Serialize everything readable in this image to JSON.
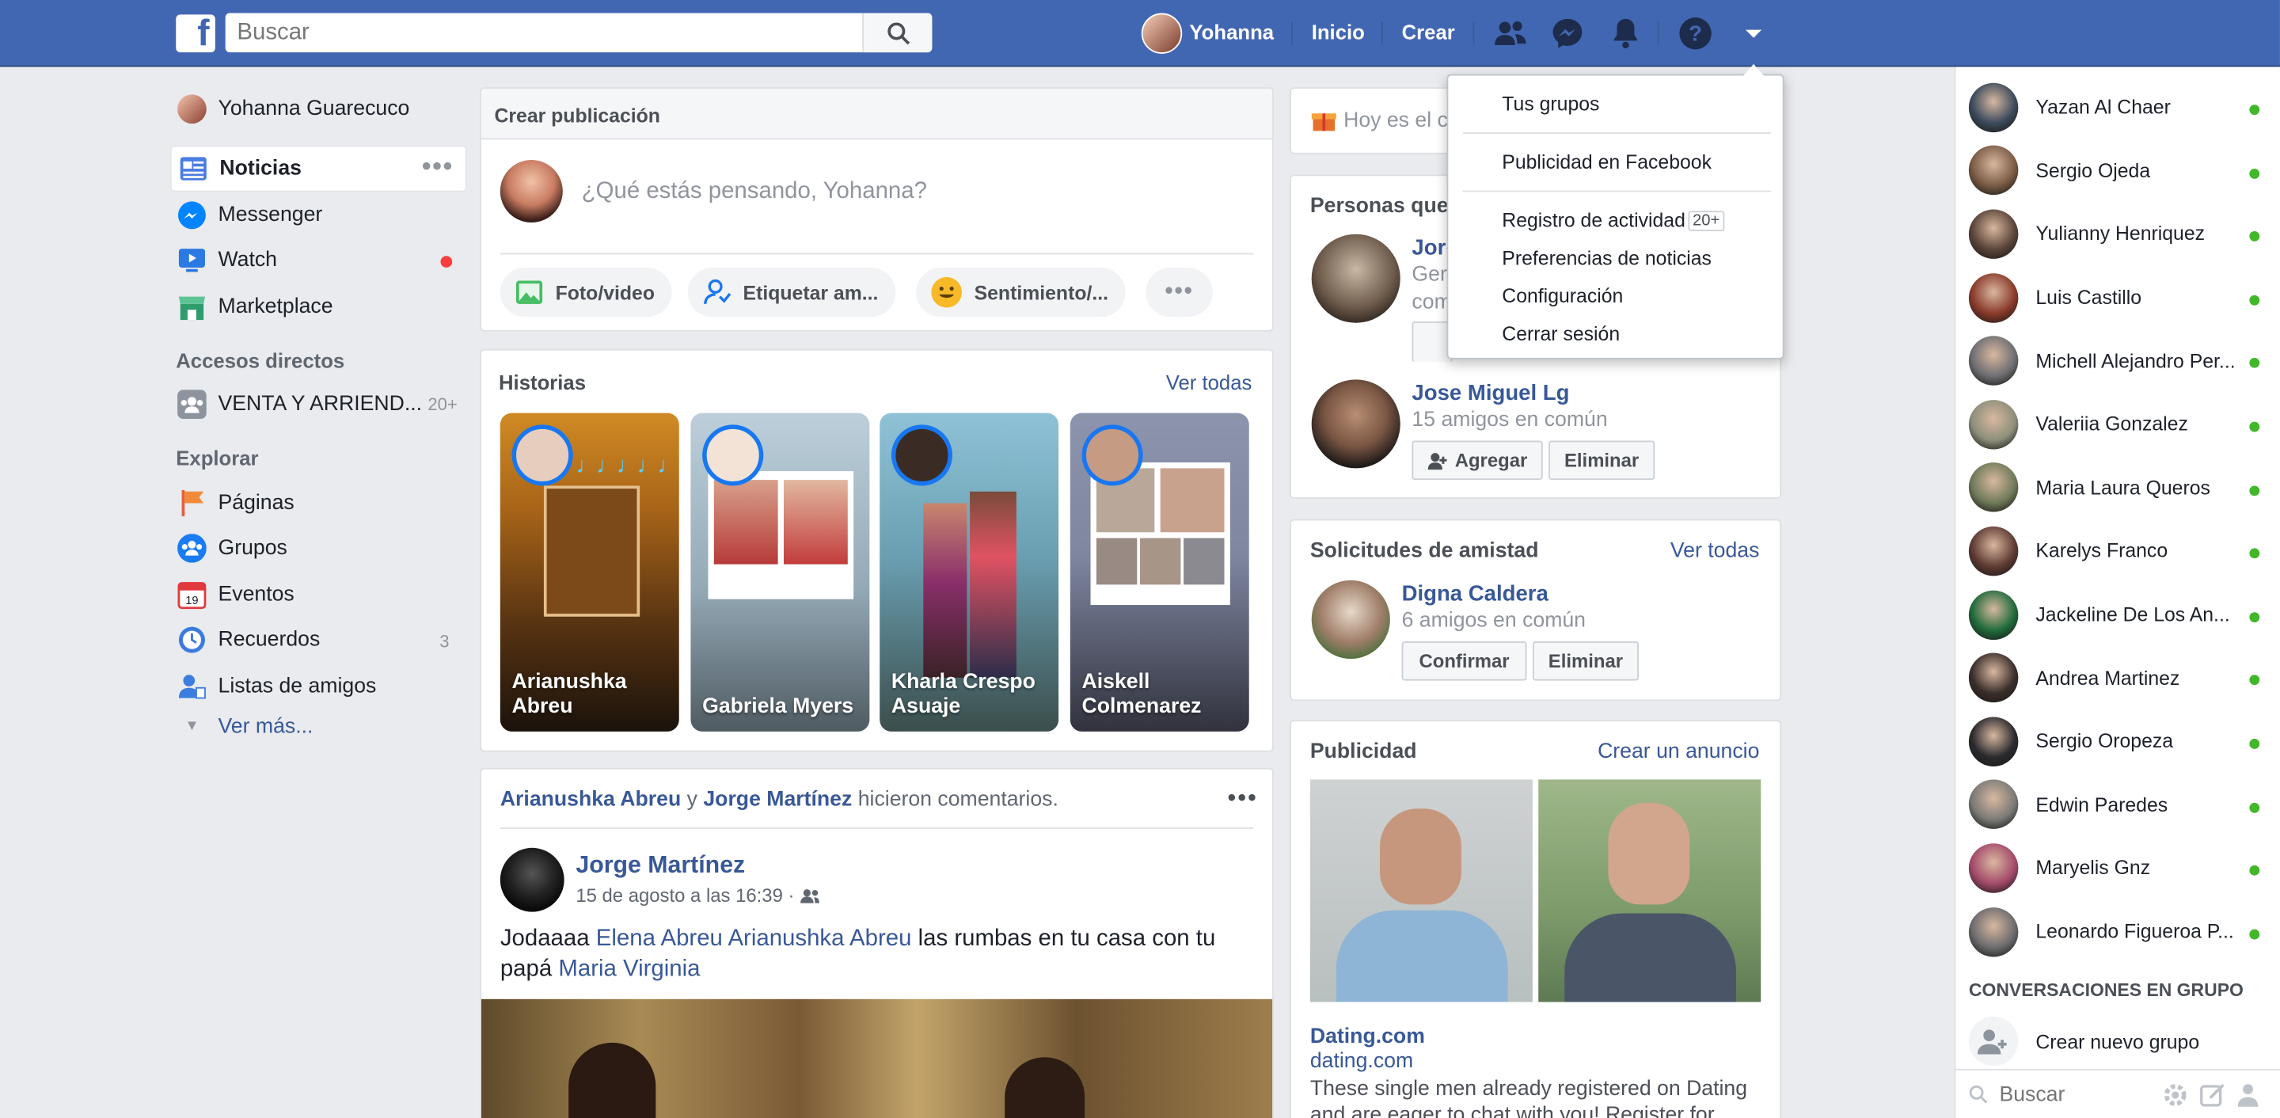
{
  "topbar": {
    "search_placeholder": "Buscar",
    "user_name": "Yohanna",
    "home": "Inicio",
    "create": "Crear"
  },
  "dropdown": {
    "items": [
      "Tus grupos",
      "Publicidad en Facebook",
      "Registro de actividad",
      "Preferencias de noticias",
      "Configuración",
      "Cerrar sesión"
    ],
    "activity_badge": "20+"
  },
  "leftnav": {
    "profile_name": "Yohanna Guarecuco",
    "items": [
      {
        "label": "Noticias"
      },
      {
        "label": "Messenger"
      },
      {
        "label": "Watch"
      },
      {
        "label": "Marketplace"
      }
    ],
    "shortcuts_title": "Accesos directos",
    "shortcut": {
      "label": "VENTA Y ARRIEND...",
      "count": "20+"
    },
    "explore_title": "Explorar",
    "explore": [
      {
        "label": "Páginas"
      },
      {
        "label": "Grupos"
      },
      {
        "label": "Eventos"
      },
      {
        "label": "Recuerdos",
        "count": "3"
      },
      {
        "label": "Listas de amigos"
      }
    ],
    "see_more": "Ver más..."
  },
  "composer": {
    "title": "Crear publicación",
    "placeholder": "¿Qué estás pensando, Yohanna?",
    "photo": "Foto/video",
    "tag": "Etiquetar am...",
    "feeling": "Sentimiento/..."
  },
  "stories": {
    "title": "Historias",
    "see_all": "Ver todas",
    "items": [
      {
        "name": "Arianushka Abreu"
      },
      {
        "name": "Gabriela Myers"
      },
      {
        "name": "Kharla Crespo Asuaje"
      },
      {
        "name": "Aiskell Colmenarez"
      }
    ]
  },
  "post": {
    "ctx_name1": "Arianushka Abreu",
    "ctx_and": " y ",
    "ctx_name2": "Jorge Martínez",
    "ctx_rest": " hicieron comentarios.",
    "author": "Jorge Martínez",
    "time": "15 de agosto a las 16:39 ·",
    "text1": "Jodaaaa ",
    "tag1": "Elena Abreu",
    "tag2": "Arianushka Abreu",
    "text2": " las rumbas en tu casa con tu papá ",
    "tag3": "Maria Virginia"
  },
  "right": {
    "birthday": "Hoy es el c",
    "pymk_title": "Personas que",
    "p1_name": "Jorg",
    "p1_line1": "Ger",
    "p1_line2": "com",
    "p2_name": "Jose Miguel Lg",
    "p2_mutual": "15 amigos en común",
    "add": "Agregar",
    "remove": "Eliminar",
    "fr_title": "Solicitudes de amistad",
    "fr_see_all": "Ver todas",
    "fr_name": "Digna Caldera",
    "fr_mutual": "6 amigos en común",
    "confirm": "Confirmar",
    "fr_remove": "Eliminar",
    "ads_title": "Publicidad",
    "ads_create": "Crear un anuncio",
    "ad_name": "Dating.com",
    "ad_url": "dating.com",
    "ad_text": "These single men already registered on Dating and are eager to chat with you! Register for"
  },
  "chat": {
    "contacts": [
      "Yazan Al Chaer",
      "Sergio Ojeda",
      "Yulianny Henriquez",
      "Luis Castillo",
      "Michell Alejandro Per...",
      "Valeriia Gonzalez",
      "Maria Laura Queros",
      "Karelys Franco",
      "Jackeline De Los An...",
      "Andrea Martinez",
      "Sergio Oropeza",
      "Edwin Paredes",
      "Maryelis Gnz",
      "Leonardo Figueroa P..."
    ],
    "group_title": "CONVERSACIONES EN GRUPO",
    "create_group": "Crear nuevo grupo",
    "search_placeholder": "Buscar"
  },
  "colors": {
    "brand": "#4267b2",
    "link": "#385898",
    "online": "#42b72a"
  }
}
